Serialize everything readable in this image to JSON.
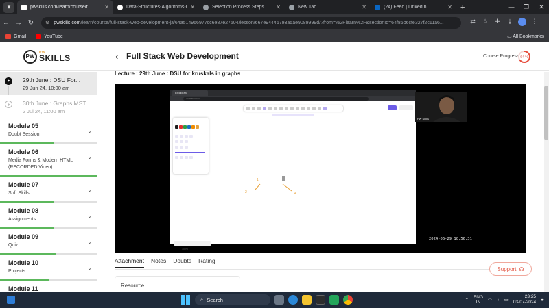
{
  "browser": {
    "tabs": [
      {
        "title": "pwskills.com/learn/course/f",
        "active": true,
        "color": "#ffffff"
      },
      {
        "title": "Data-Structures-Algorithms-Pr",
        "active": false,
        "color": "#ffffff"
      },
      {
        "title": "Selection Process Steps",
        "active": false,
        "color": "#9aa0a6"
      },
      {
        "title": "New Tab",
        "active": false,
        "color": "#9aa0a6"
      },
      {
        "title": "(24) Feed | LinkedIn",
        "active": false,
        "color": "#0a66c2"
      }
    ],
    "url_host": "pwskills.com",
    "url_path": "/learn/course/full-stack-web-development-ja/64a514966977cc6e87e27504/lesson/667e94446793a5ae9089999d/?from=%2Flearn%2F&sectionId=64f86b6cfe327f2c11a6...",
    "bookmarks": [
      {
        "label": "Gmail",
        "color": "#ea4335"
      },
      {
        "label": "YouTube",
        "color": "#ff0000"
      }
    ],
    "all_bookmarks": "All Bookmarks"
  },
  "header": {
    "logo_small": "PW",
    "logo_text": "SKILLS",
    "logo_badge": "PW",
    "course_title": "Full Stack Web Development",
    "progress_label": "Course Progress",
    "progress_value": "64 %",
    "progress_fraction": 0.64
  },
  "sidebar": {
    "lessons": [
      {
        "title": "29th June : DSU For...",
        "date": "29 Jun 24, 10:00 am",
        "current": true
      },
      {
        "title": "30th June : Graphs MST",
        "date": "2 Jul 24, 11:00 am",
        "current": false
      }
    ],
    "modules": [
      {
        "title": "Module 05",
        "sub": "Doubt Session",
        "progress": 0.55
      },
      {
        "title": "Module 06",
        "sub": "Media Forms & Modern HTML (RECORDED Video)",
        "progress": 1.0
      },
      {
        "title": "Module 07",
        "sub": "Soft Skills",
        "progress": 0.55
      },
      {
        "title": "Module 08",
        "sub": "Assignments",
        "progress": 0.55
      },
      {
        "title": "Module 09",
        "sub": "Quiz",
        "progress": 0.58
      },
      {
        "title": "Module 10",
        "sub": "Projects",
        "progress": 0.5
      },
      {
        "title": "Module 11",
        "sub": "",
        "progress": 0.0
      }
    ]
  },
  "lecture": {
    "title": "Lecture : 29th June : DSU for kruskals in graphs",
    "inner_tab": "Excalidraw",
    "inner_url": "excalidraw.com",
    "presenter": "PW Skills",
    "timestamp": "2024-06-29 10:56:31",
    "zoom": "100%",
    "sketch_labels": [
      "1",
      "2",
      "4"
    ]
  },
  "content_tabs": [
    "Attachment",
    "Notes",
    "Doubts",
    "Rating"
  ],
  "resource_label": "Resource",
  "support_label": "Support",
  "taskbar": {
    "search": "Search",
    "lang_top": "ENG",
    "lang_bottom": "IN",
    "time": "23:25",
    "date": "03-07-2024"
  }
}
